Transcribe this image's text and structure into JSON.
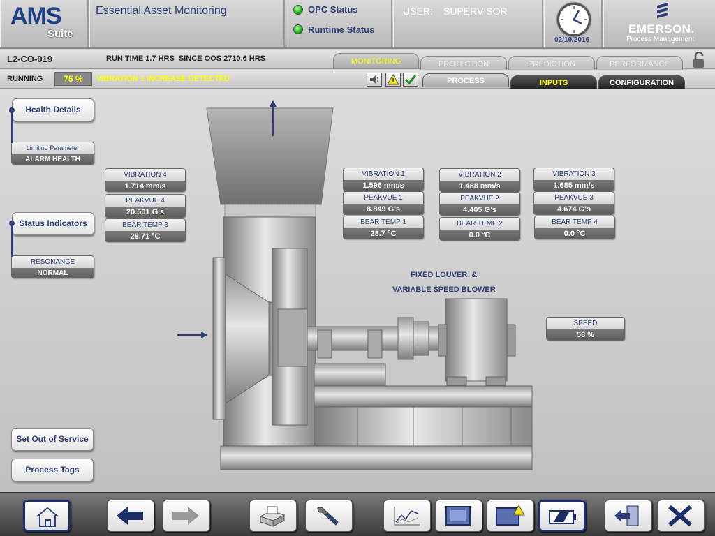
{
  "header": {
    "logo_main": "AMS",
    "logo_sub": "Suite",
    "app_title": "Essential Asset Monitoring",
    "opc_status": "OPC Status",
    "runtime_status": "Runtime Status",
    "user_label": "USER:",
    "user_value": "SUPERVISOR",
    "date": "02/19/2016",
    "brand": "EMERSON.",
    "brand_sub": "Process Management",
    "status_color": "#1fae16"
  },
  "asset": {
    "id": "L2-CO-019",
    "runtime": "RUN TIME 1.7 HRS  SINCE OOS 2710.6 HRS",
    "state": "RUNNING",
    "percent": "75 %",
    "alert": "VIBRATION 1 INCREASE DETECTED",
    "alert_color": "#ffff00"
  },
  "tabs_top": [
    {
      "label": "MONITORING",
      "active": true
    },
    {
      "label": "PROTECTION",
      "active": false
    },
    {
      "label": "PREDICTION",
      "active": false
    },
    {
      "label": "PERFORMANCE",
      "active": false
    }
  ],
  "tabs_sub": [
    {
      "label": "PROCESS",
      "active": true
    },
    {
      "label": "INPUTS",
      "active": false
    },
    {
      "label": "CONFIGURATION",
      "active": false
    }
  ],
  "left": {
    "health_details": "Health Details",
    "limiting_label": "Limiting Parameter",
    "limiting_value": "ALARM HEALTH",
    "status_indicators": "Status Indicators",
    "resonance_label": "RESONANCE",
    "resonance_value": "NORMAL",
    "set_oos": "Set Out of Service",
    "process_tags": "Process Tags"
  },
  "sensors": {
    "vib4": {
      "label": "VIBRATION 4",
      "value": "1.714  mm/s"
    },
    "pk4": {
      "label": "PEAKVUE 4",
      "value": "20.501  G's"
    },
    "bt3": {
      "label": "BEAR TEMP 3",
      "value": "28.71  °C"
    },
    "vib1": {
      "label": "VIBRATION 1",
      "value": "1.596  mm/s"
    },
    "pk1": {
      "label": "PEAKVUE 1",
      "value": "8.849  G's"
    },
    "bt1": {
      "label": "BEAR TEMP 1",
      "value": "28.7  °C"
    },
    "vib2": {
      "label": "VIBRATION 2",
      "value": "1.468  mm/s"
    },
    "pk2": {
      "label": "PEAKVUE 2",
      "value": "4.405  G's"
    },
    "bt2": {
      "label": "BEAR TEMP 2",
      "value": "0.0  °C"
    },
    "vib3": {
      "label": "VIBRATION 3",
      "value": "1.685  mm/s"
    },
    "pk3": {
      "label": "PEAKVUE 3",
      "value": "4.674  G's"
    },
    "bt4": {
      "label": "BEAR TEMP 4",
      "value": "0.0  °C"
    },
    "speed": {
      "label": "SPEED",
      "value": "58  %"
    }
  },
  "diagram": {
    "caption1": "FIXED LOUVER  &",
    "caption2": "VARIABLE SPEED BLOWER"
  },
  "toolbar": [
    {
      "icon": "home-icon"
    },
    {
      "icon": "back-arrow-icon"
    },
    {
      "icon": "forward-arrow-icon"
    },
    {
      "icon": "print-icon"
    },
    {
      "icon": "wrench-icon"
    },
    {
      "icon": "trend-chart-icon"
    },
    {
      "icon": "display-icon"
    },
    {
      "icon": "alarm-display-icon"
    },
    {
      "icon": "battery-icon"
    },
    {
      "icon": "logout-icon"
    },
    {
      "icon": "close-icon"
    }
  ]
}
